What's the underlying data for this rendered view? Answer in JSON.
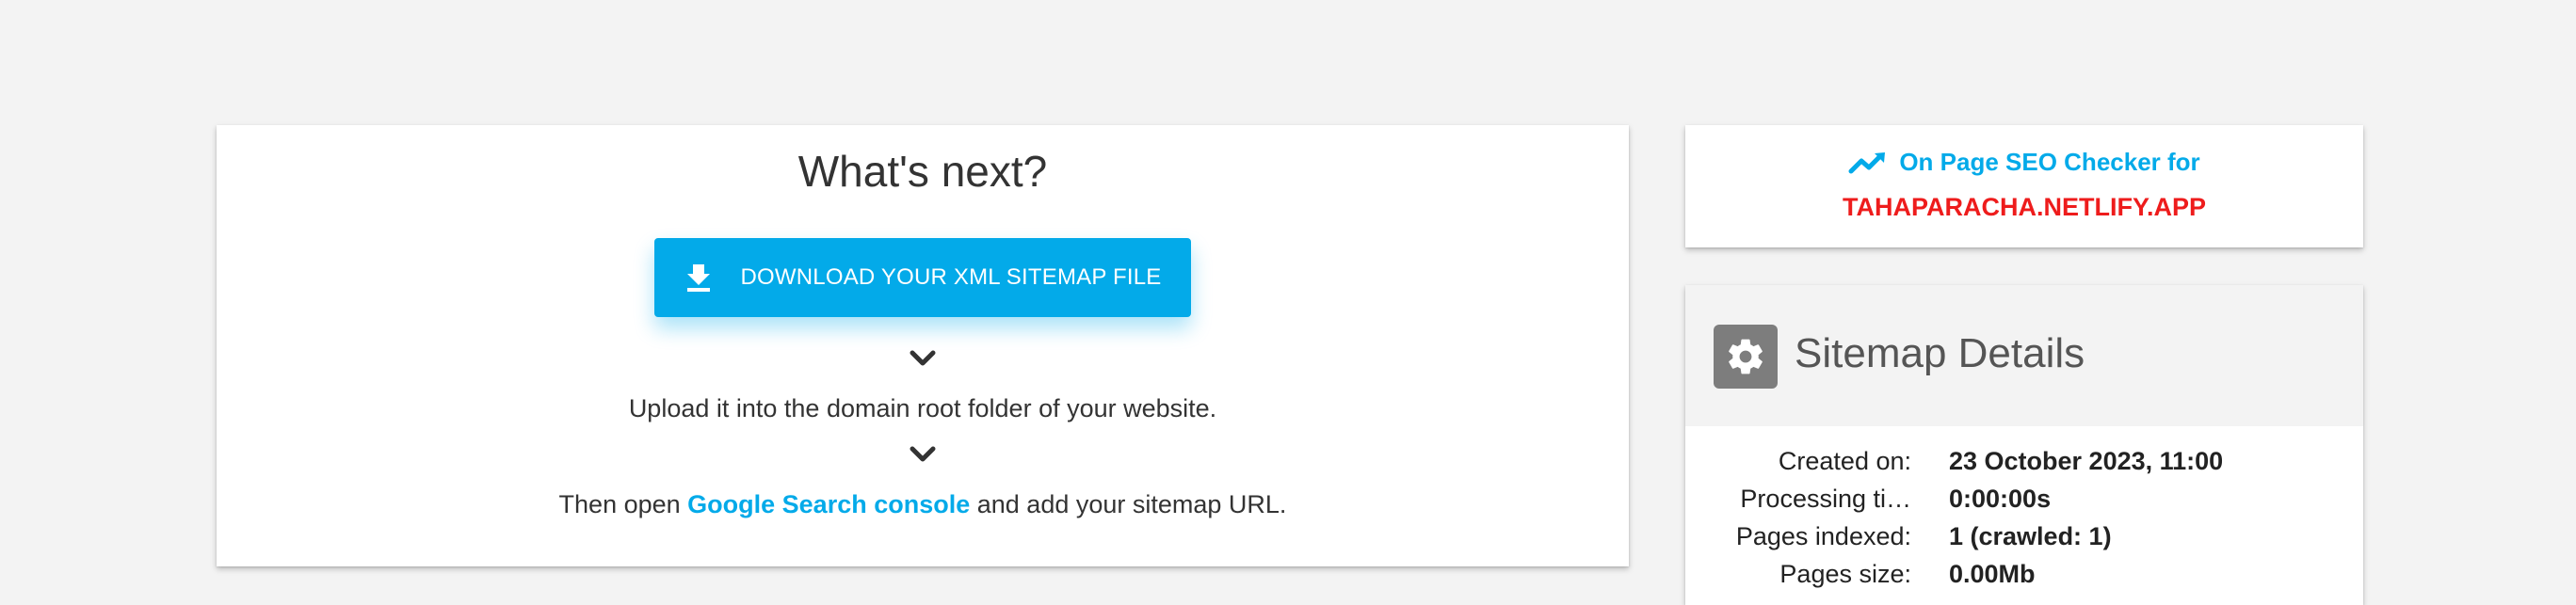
{
  "next": {
    "title": "What's next?",
    "download_label": "DOWNLOAD YOUR XML SITEMAP FILE",
    "step1": "Upload it into the domain root folder of your website.",
    "step2_before": "Then open ",
    "step2_link": "Google Search console",
    "step2_after": " and add your sitemap URL."
  },
  "seo": {
    "title": "On Page SEO Checker for",
    "domain": "TAHAPARACHA.NETLIFY.APP"
  },
  "details": {
    "title": "Sitemap Details",
    "rows": [
      {
        "label": "Created on:",
        "value": "23 October 2023, 11:00"
      },
      {
        "label": "Processing ti…",
        "value": "0:00:00s"
      },
      {
        "label": "Pages indexed:",
        "value": "1 (crawled: 1)"
      },
      {
        "label": "Pages size:",
        "value": "0.00Mb"
      }
    ]
  },
  "colors": {
    "accent": "#03aae9",
    "domain": "#ee1c1c",
    "background": "#f3f3f3"
  },
  "icons": {
    "download": "download-icon",
    "chevron": "chevron-down-icon",
    "trend": "trending-up-icon",
    "gear": "gear-icon"
  }
}
